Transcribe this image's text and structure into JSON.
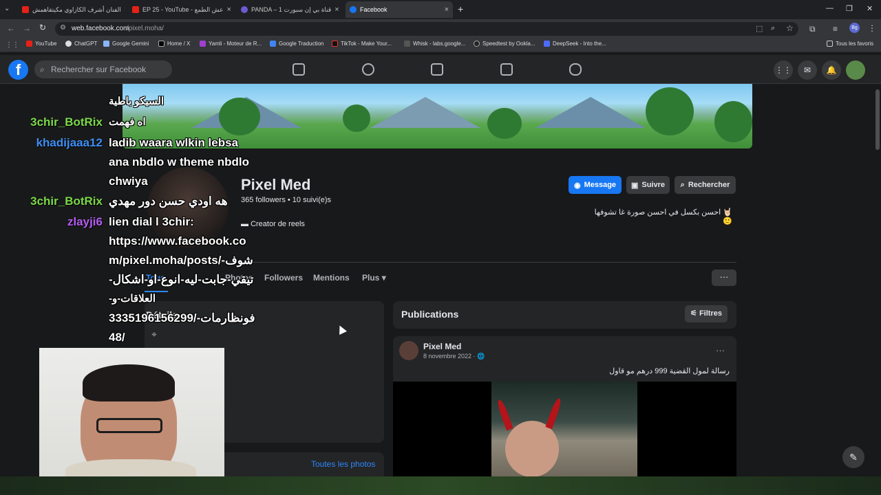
{
  "browser": {
    "tabs": [
      {
        "title": "الفنان أشرف الكازاوي مكيتقاهمش"
      },
      {
        "title": "EP 25 - YouTube - عش الطمع"
      },
      {
        "title": "PANDA – قناة بي إن سبورت 1"
      },
      {
        "title": "Facebook"
      }
    ],
    "url": "web.facebook.com/pixel.moha/",
    "url_host": "web.facebook.com",
    "url_path": "/pixel.moha/",
    "bookmarks": [
      "YouTube",
      "ChatGPT",
      "Google Gemini",
      "Home / X",
      "Yamli - Moteur de R...",
      "Google Traduction",
      "TikTok - Make Your...",
      "Whisk - labs.google...",
      "Speedtest by Ookla...",
      "DeepSeek - Into the..."
    ],
    "all_favorites": "Tous les favoris"
  },
  "facebook": {
    "search_placeholder": "Rechercher sur Facebook",
    "profile": {
      "name": "Pixel Med",
      "stats": "365 followers • 10 suivi(e)s",
      "creator": "Creator de reels",
      "bio": "احسن بكسل في احسن صورة غا تشوفها 🤘🏻🙂"
    },
    "buttons": {
      "message": "Message",
      "follow": "Suivre",
      "search": "Rechercher"
    },
    "tabs": [
      "Tous",
      "Photos",
      "Followers",
      "Mentions",
      "Plus"
    ],
    "details_label": "Détails",
    "all_photos": "Toutes les photos",
    "publications": {
      "title": "Publications",
      "filters": "Filtres"
    },
    "post": {
      "author": "Pixel Med",
      "date": "8 novembre 2022 · 🌐",
      "text": "رسالة لمول القضية 999 درهم مو قاول"
    }
  },
  "chat": {
    "lines": [
      {
        "user": "",
        "text": "السيكو باطية"
      },
      {
        "user": "3chir_BotRix",
        "text": "اه فهمت"
      },
      {
        "user": "khadijaaa12",
        "text": "ladib waara wlkin lebsa"
      },
      {
        "user": "",
        "text": "ana nbdlo w theme nbdlo"
      },
      {
        "user": "",
        "text": "chwiya"
      },
      {
        "user": "3chir_BotRix",
        "text": "هه اودي حسن دور مهدي"
      },
      {
        "user": "zlayji6",
        "text": "lien dial l 3chir:"
      },
      {
        "user": "",
        "text": "https://www.facebook.co"
      },
      {
        "user": "",
        "text": "m/pixel.moha/posts/-شوف"
      },
      {
        "user": "",
        "text": "-تيقي-جابت-ليه-انوع-او-اشكال"
      },
      {
        "user": "",
        "text": "-العلاقات-و"
      },
      {
        "user": "",
        "text": "3335196156299/-فونظارمات"
      },
      {
        "user": "",
        "text": "48/"
      }
    ],
    "colors": {
      "3chir_BotRix": "#7bd94a",
      "khadijaaa12": "#3e8ef5",
      "zlayji6": "#b45cf0"
    }
  },
  "colors": {
    "accent": "#1877f2",
    "link": "#2d88ff",
    "background": "#18191a",
    "card": "#242526"
  }
}
